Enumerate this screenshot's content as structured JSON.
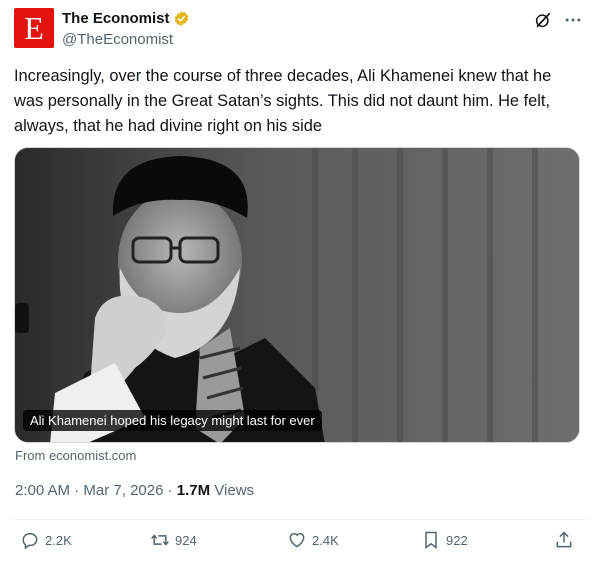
{
  "account": {
    "avatar_letter": "E",
    "display_name": "The Economist",
    "handle": "@TheEconomist",
    "verified_color": "#e2b719",
    "brand_color": "#e3120b"
  },
  "tweet": {
    "text": "Increasingly, over the course of three decades, Ali Khamenei knew that he was personally in the Great Satan’s sights. This did not daunt him. He felt, always, that he had divine right on his side"
  },
  "media": {
    "caption": "Ali Khamenei hoped his legacy might last for ever",
    "source": "From economist.com"
  },
  "meta": {
    "time": "2:00 AM",
    "separator": "·",
    "date": "Mar 7, 2026",
    "views_count": "1.7M",
    "views_label": "Views"
  },
  "actions": {
    "replies": "2.2K",
    "reposts": "924",
    "likes": "2.4K",
    "bookmarks": "922"
  },
  "icons": [
    "verified-icon",
    "grok-icon",
    "more-icon",
    "reply-icon",
    "repost-icon",
    "like-icon",
    "bookmark-icon",
    "share-icon"
  ]
}
